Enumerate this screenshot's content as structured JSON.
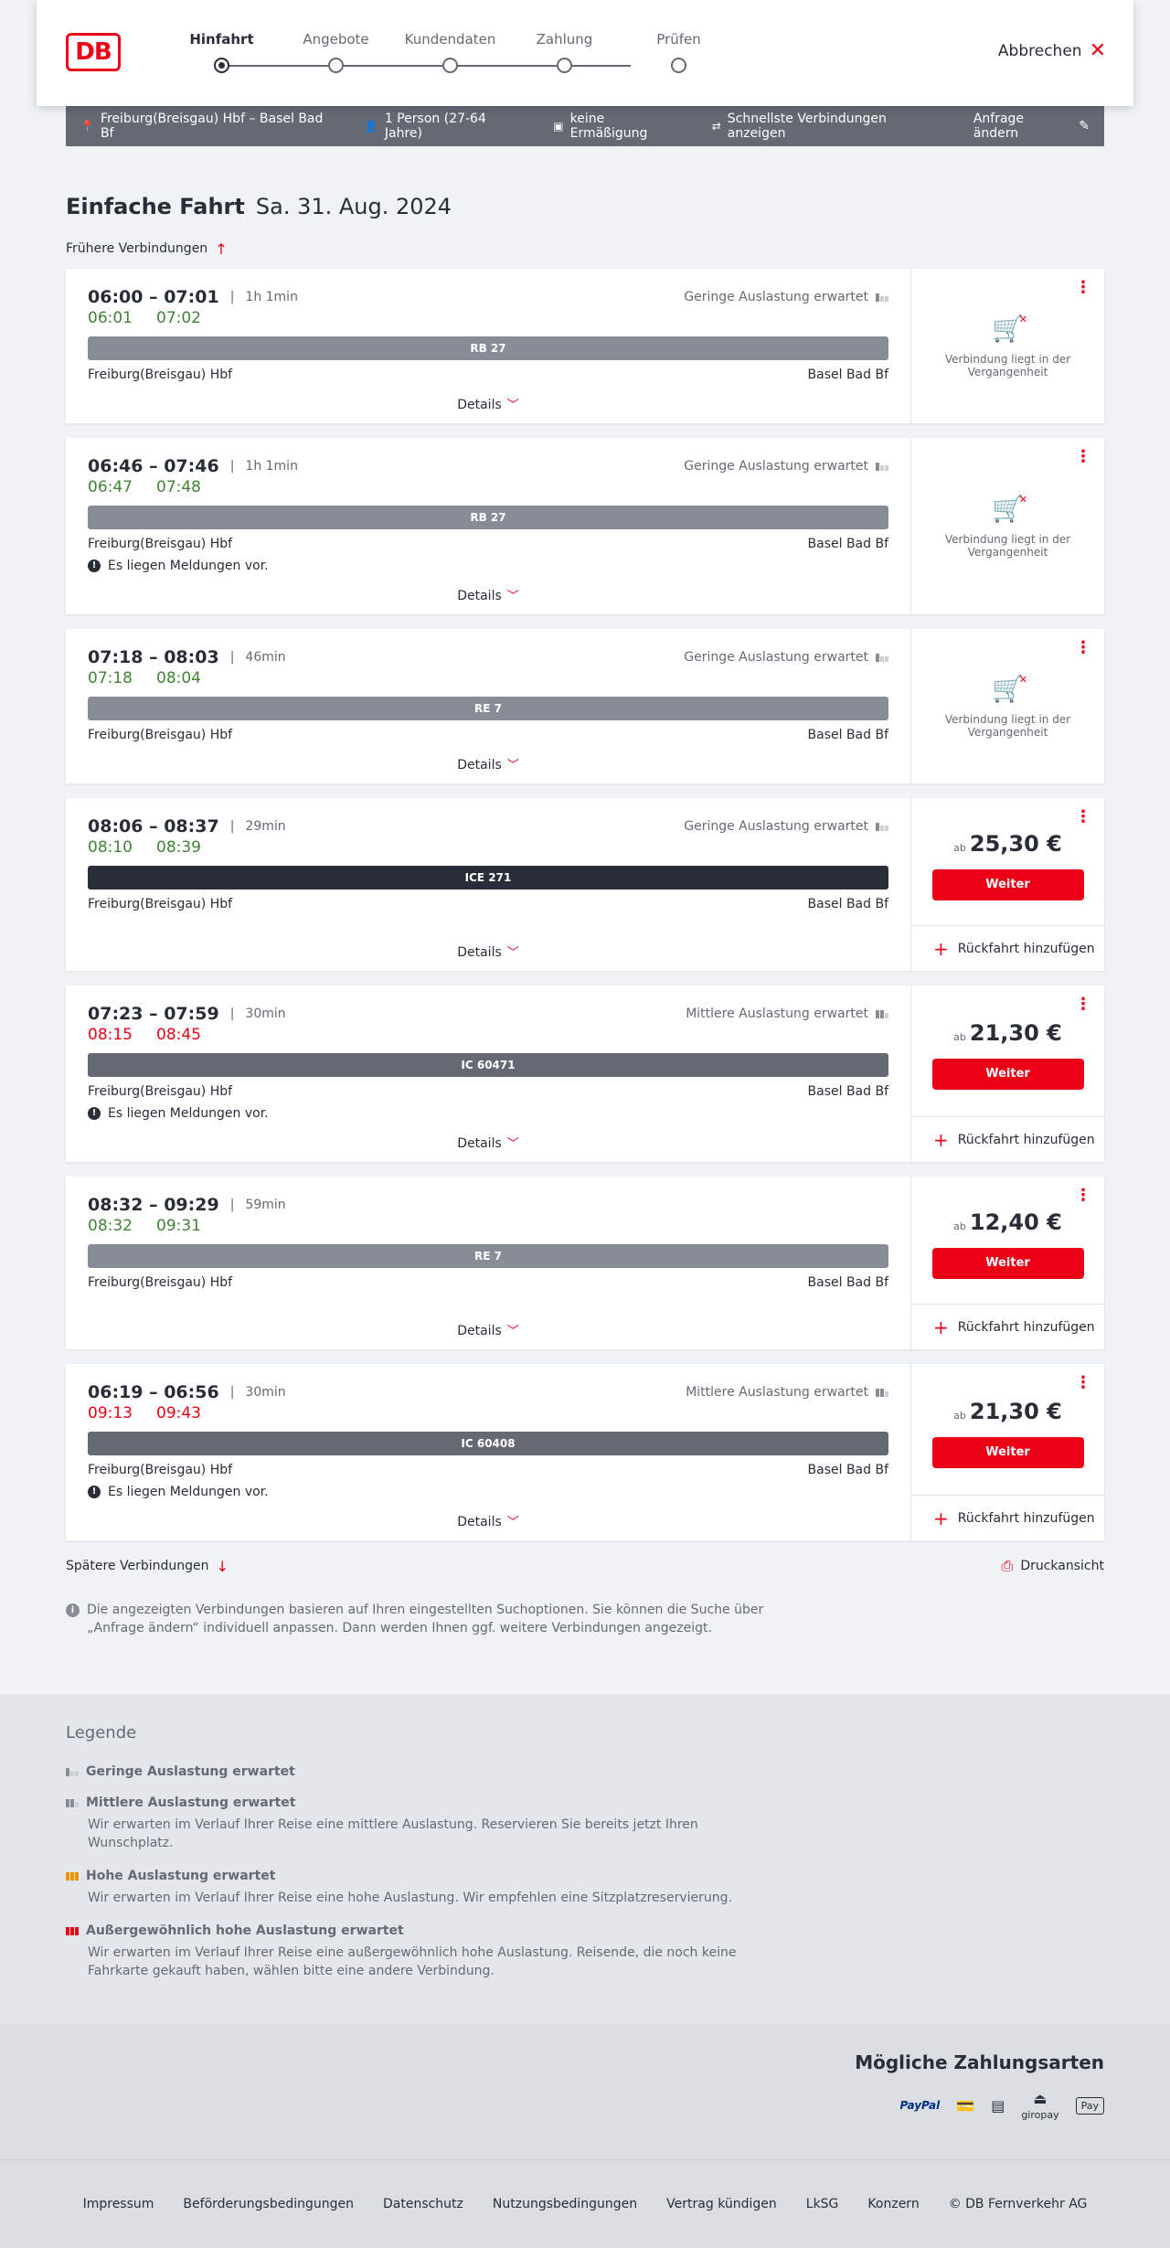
{
  "header": {
    "logo_text": "DB",
    "steps": [
      {
        "label": "Hinfahrt"
      },
      {
        "label": "Angebote"
      },
      {
        "label": "Kundendaten"
      },
      {
        "label": "Zahlung"
      },
      {
        "label": "Prüfen"
      }
    ],
    "cancel_label": "Abbrechen"
  },
  "search": {
    "route": "Freiburg(Breisgau) Hbf – Basel Bad Bf",
    "travellers": "1 Person (27-64 Jahre)",
    "discount": "keine Ermäßigung",
    "fastest": "Schnellste Verbindungen anzeigen",
    "change_label": "Anfrage ändern"
  },
  "page": {
    "title_bold": "Einfache Fahrt",
    "title_date": "Sa. 31. Aug. 2024",
    "earlier_label": "Frühere Verbindungen",
    "later_label": "Spätere Verbindungen",
    "print_label": "Druckansicht",
    "info_text": "Die angezeigten Verbindungen basieren auf Ihren eingestellten Suchoptionen. Sie können die Suche über „Anfrage ändern“ individuell anpassen. Dann werden Ihnen ggf. weitere Verbindungen angezeigt."
  },
  "connections": [
    {
      "times": "06:00 – 07:01",
      "duration": "1h 1min",
      "load": "Geringe Auslastung erwartet",
      "rt_dep": "06:01",
      "rt_arr": "07:02",
      "train": "RB 27",
      "from": "Freiburg(Breisgau) Hbf",
      "to": "Basel Bad Bf",
      "details": "Details",
      "past_text": "Verbindung liegt in der Vergangenheit"
    },
    {
      "times": "06:46 – 07:46",
      "duration": "1h 1min",
      "load": "Geringe Auslastung erwartet",
      "rt_dep": "06:47",
      "rt_arr": "07:48",
      "train": "RB 27",
      "from": "Freiburg(Breisgau) Hbf",
      "to": "Basel Bad Bf",
      "notice": "Es liegen Meldungen vor.",
      "details": "Details",
      "past_text": "Verbindung liegt in der Vergangenheit"
    },
    {
      "times": "07:18 – 08:03",
      "duration": "46min",
      "load": "Geringe Auslastung erwartet",
      "rt_dep": "07:18",
      "rt_arr": "08:04",
      "train": "RE 7",
      "from": "Freiburg(Breisgau) Hbf",
      "to": "Basel Bad Bf",
      "details": "Details",
      "past_text": "Verbindung liegt in der Vergangenheit"
    },
    {
      "times": "08:06 – 08:37",
      "duration": "29min",
      "load": "Geringe Auslastung erwartet",
      "rt_dep": "08:10",
      "rt_arr": "08:39",
      "train": "ICE 271",
      "from": "Freiburg(Breisgau) Hbf",
      "to": "Basel Bad Bf",
      "details": "Details",
      "price_prefix": "ab",
      "price": "25,30 €",
      "button": "Weiter",
      "return": "Rückfahrt hinzufügen"
    },
    {
      "times": "07:23 – 07:59",
      "duration": "30min",
      "load": "Mittlere Auslastung erwartet",
      "rt_dep": "08:15",
      "rt_arr": "08:45",
      "train": "IC 60471",
      "from": "Freiburg(Breisgau) Hbf",
      "to": "Basel Bad Bf",
      "notice": "Es liegen Meldungen vor.",
      "details": "Details",
      "price_prefix": "ab",
      "price": "21,30 €",
      "button": "Weiter",
      "return": "Rückfahrt hinzufügen"
    },
    {
      "times": "08:32 – 09:29",
      "duration": "59min",
      "load": "",
      "rt_dep": "08:32",
      "rt_arr": "09:31",
      "train": "RE 7",
      "from": "Freiburg(Breisgau) Hbf",
      "to": "Basel Bad Bf",
      "details": "Details",
      "price_prefix": "ab",
      "price": "12,40 €",
      "button": "Weiter",
      "return": "Rückfahrt hinzufügen"
    },
    {
      "times": "06:19 – 06:56",
      "duration": "30min",
      "load": "Mittlere Auslastung erwartet",
      "rt_dep": "09:13",
      "rt_arr": "09:43",
      "train": "IC 60408",
      "from": "Freiburg(Breisgau) Hbf",
      "to": "Basel Bad Bf",
      "notice": "Es liegen Meldungen vor.",
      "details": "Details",
      "price_prefix": "ab",
      "price": "21,30 €",
      "button": "Weiter",
      "return": "Rückfahrt hinzufügen"
    }
  ],
  "legend": {
    "title": "Legende",
    "items": [
      {
        "title": "Geringe Auslastung erwartet",
        "text": ""
      },
      {
        "title": "Mittlere Auslastung erwartet",
        "text": "Wir erwarten im Verlauf Ihrer Reise eine mittlere Auslastung. Reservieren Sie bereits jetzt Ihren Wunschplatz."
      },
      {
        "title": "Hohe Auslastung erwartet",
        "text": "Wir erwarten im Verlauf Ihrer Reise eine hohe Auslastung. Wir empfehlen eine Sitzplatzreservierung."
      },
      {
        "title": "Außergewöhnlich hohe Auslastung erwartet",
        "text": "Wir erwarten im Verlauf Ihrer Reise eine außergewöhnlich hohe Auslastung. Reisende, die noch keine Fahrkarte gekauft haben, wählen bitte eine andere Verbindung."
      }
    ]
  },
  "payment": {
    "title": "Mögliche Zahlungsarten",
    "paypal": "PayPal",
    "giropay": "giropay",
    "applepay": "Pay"
  },
  "footer": {
    "links": [
      "Impressum",
      "Beförderungsbedingungen",
      "Datenschutz",
      "Nutzungsbedingungen",
      "Vertrag kündigen",
      "LkSG",
      "Konzern",
      "© DB Fernverkehr AG"
    ]
  },
  "colors": {
    "accent": "#ec0016",
    "green": "#408335",
    "dark": "#282d37",
    "grey": "#646973"
  }
}
